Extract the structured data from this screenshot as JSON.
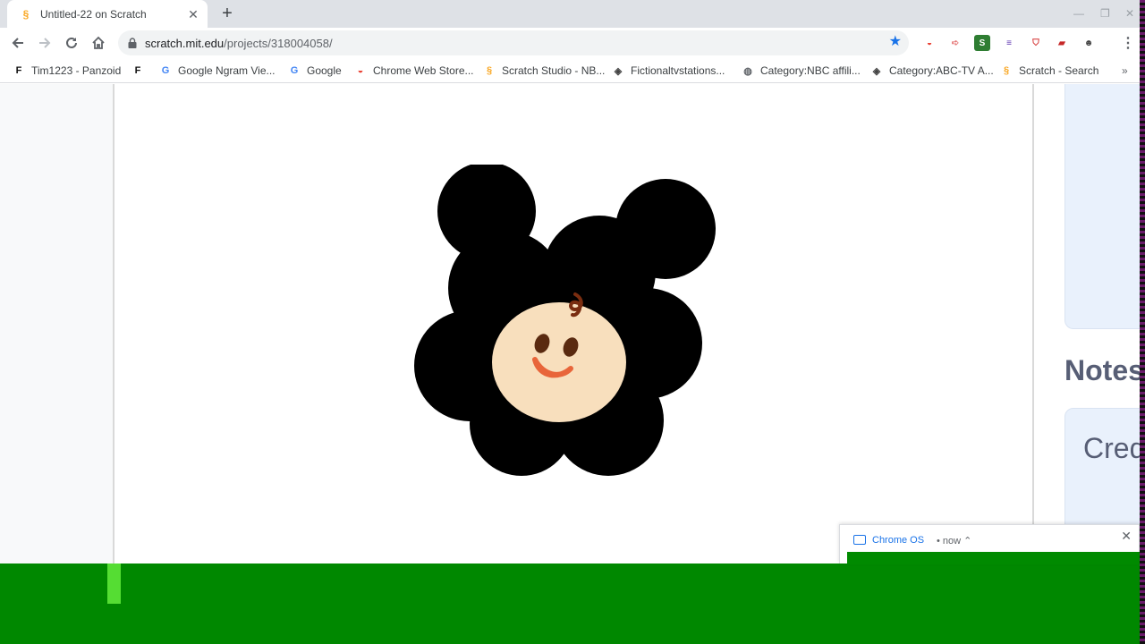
{
  "tab": {
    "title": "Untitled-22 on Scratch"
  },
  "omnibox": {
    "host": "scratch.mit.edu",
    "path": "/projects/318004058/"
  },
  "bookmarks": [
    {
      "label": "Tim1223 - Panzoid",
      "icon": "panzoid-icon"
    },
    {
      "label": "",
      "icon": "panzoid-icon"
    },
    {
      "label": "Google Ngram Vie...",
      "icon": "google-icon"
    },
    {
      "label": "Google",
      "icon": "google-icon"
    },
    {
      "label": "Chrome Web Store...",
      "icon": "chrome-web-store-icon"
    },
    {
      "label": "Scratch Studio - NB...",
      "icon": "scratch-icon"
    },
    {
      "label": "Fictionaltvstations...",
      "icon": "fandom-icon"
    },
    {
      "label": "Category:NBC affili...",
      "icon": "globe-icon"
    },
    {
      "label": "Category:ABC-TV A...",
      "icon": "fandom-icon"
    },
    {
      "label": "Scratch - Search",
      "icon": "scratch-icon"
    }
  ],
  "page": {
    "notes_title": "Notes",
    "credits_text": "Cred"
  },
  "notification": {
    "source": "Chrome OS",
    "time": "now"
  },
  "colors": {
    "accent": "#1a73e8",
    "green_overlay": "#008800",
    "tab_strip": "#dee1e6"
  }
}
